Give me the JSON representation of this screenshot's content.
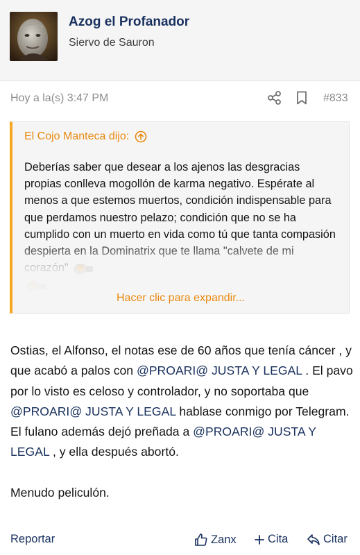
{
  "user": {
    "name": "Azog el Profanador",
    "title": "Siervo de Sauron"
  },
  "meta": {
    "date": "Hoy a la(s) 3:47 PM",
    "post_number": "#833"
  },
  "quote": {
    "author": "El Cojo Manteca dijo:",
    "text": "Deberías saber que desear a los ajenos las desgracias propias conlleva mogollón de karma negativo. Espérate al menos a que estemos muertos, condición indispensable para que perdamos nuestro pelazo; condición que no se ha cumplido con un muerto en vida como tú que tanta compasión despierta en la Dominatrix que te llama \"calvete de mi corazón\"",
    "expand_label": "Hacer clic para expandir..."
  },
  "post": {
    "p1_a": "Ostias, el Alfonso, el notas ese de 60 años que tenía cáncer , y que acabó a palos con ",
    "mention": "@PROARI@ JUSTA Y LEGAL",
    "p1_b": " . El pavo por lo visto es celoso y controlador, y no soportaba que ",
    "p1_c": " hablase conmigo por Telegram. El fulano además dejó preñada a ",
    "p1_d": " , y ella después abortó.",
    "p2": "Menudo peliculón."
  },
  "footer": {
    "report": "Reportar",
    "like": "Zanx",
    "quote": "Cita",
    "reply": "Citar"
  },
  "colors": {
    "accent_orange": "#e9890f",
    "quote_border": "#f5a623",
    "link_blue": "#18305d"
  }
}
